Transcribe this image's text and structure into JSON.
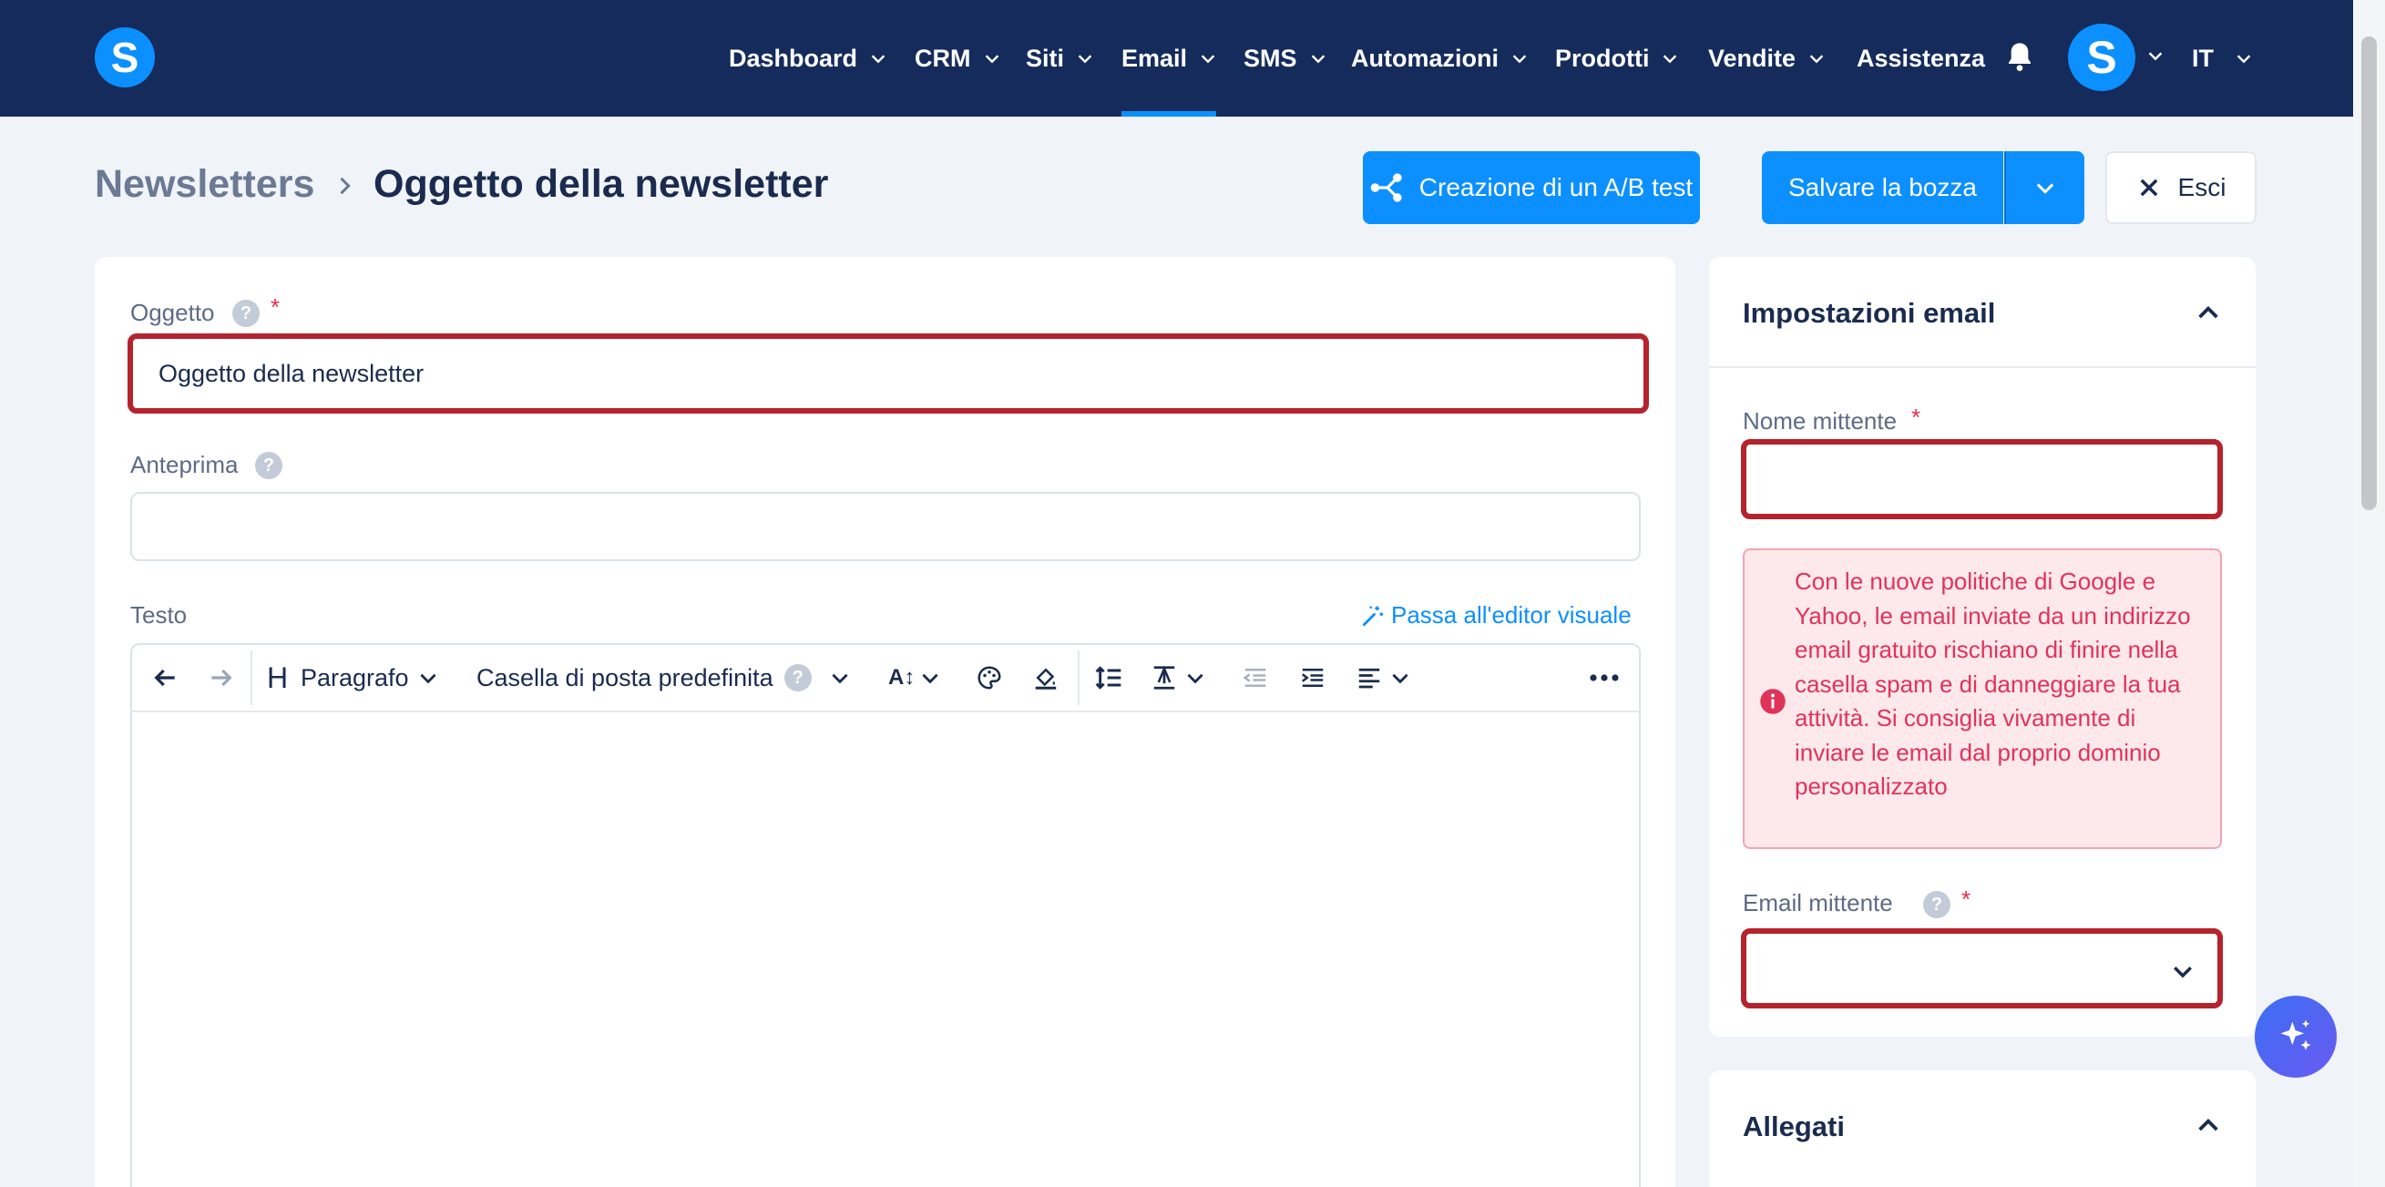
{
  "header": {
    "logo_letter": "S",
    "nav": [
      {
        "label": "Dashboard"
      },
      {
        "label": "CRM"
      },
      {
        "label": "Siti"
      },
      {
        "label": "Email"
      },
      {
        "label": "SMS"
      },
      {
        "label": "Automazioni"
      },
      {
        "label": "Prodotti"
      },
      {
        "label": "Vendite"
      },
      {
        "label": "Assistenza"
      }
    ],
    "active_nav": "Email",
    "avatar_letter": "S",
    "language": "IT"
  },
  "breadcrumb": {
    "parent": "Newsletters",
    "current": "Oggetto della newsletter"
  },
  "actions": {
    "ab_test": "Creazione di un A/B test",
    "save_draft": "Salvare la bozza",
    "exit": "Esci"
  },
  "form": {
    "subject_label": "Oggetto",
    "subject_value": "Oggetto della newsletter",
    "preview_label": "Anteprima",
    "preview_value": "",
    "text_label": "Testo",
    "visual_editor_link": "Passa all'editor visuale",
    "help_symbol": "?",
    "required_mark": "*"
  },
  "toolbar": {
    "heading_letter": "H",
    "paragraph": "Paragrafo",
    "mailbox": "Casella di posta predefinita",
    "font_size_icon": "A↕"
  },
  "settings": {
    "title": "Impostazioni email",
    "sender_name_label": "Nome mittente",
    "sender_name_value": "",
    "warning": "Con le nuove politiche di Google e Yahoo, le email inviate da un indirizzo email gratuito rischiano di finire nella casella spam e di danneggiare la tua attività. Si consiglia vivamente di inviare le email dal proprio dominio personalizzato",
    "sender_email_label": "Email mittente",
    "sender_email_value": ""
  },
  "attachments": {
    "title": "Allegati"
  },
  "colors": {
    "header_bg": "#152b5c",
    "primary": "#0c8fff",
    "error": "#b5232c",
    "warning_text": "#e0335a"
  }
}
